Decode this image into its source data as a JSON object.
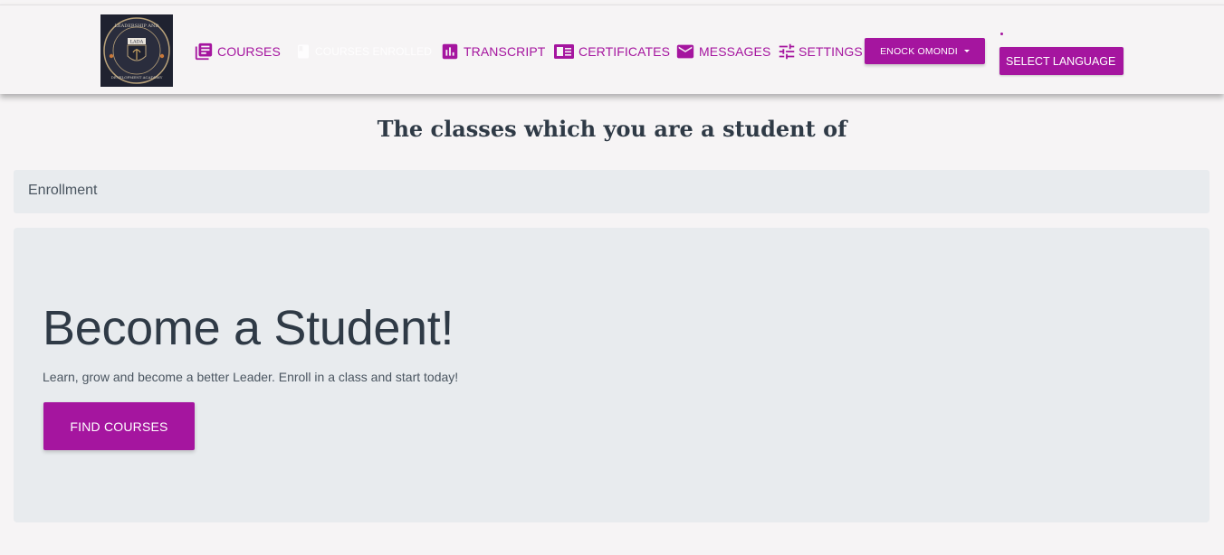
{
  "brand": {
    "logo_text_top": "LEADERSHIP AND",
    "logo_abbr": "LADA",
    "logo_text_bottom": "DEVELOPMENT ACADEMY"
  },
  "nav": {
    "items": [
      {
        "label": "COURSES",
        "icon": "library-books-icon"
      },
      {
        "label": "COURSES ENROLLED",
        "icon": "book-icon"
      },
      {
        "label": "TRANSCRIPT",
        "icon": "bar-chart-icon"
      },
      {
        "label": "CERTIFICATES",
        "icon": "certificate-icon"
      },
      {
        "label": "MESSAGES",
        "icon": "mail-icon"
      },
      {
        "label": "SETTINGS",
        "icon": "tune-icon"
      }
    ],
    "user_menu_label": "ENOCK OMONDI",
    "language_button_label": "SELECT LANGUAGE"
  },
  "main": {
    "title": "The classes which you are a student of",
    "enrollment_header": "Enrollment",
    "jumbotron": {
      "heading": "Become a Student!",
      "text": "Learn, grow and become a better Leader. Enroll in a class and start today!",
      "button_label": "FIND COURSES"
    }
  },
  "colors": {
    "accent": "#a5159f",
    "page_bg": "#f6f4f5",
    "card_bg": "#e8ebee",
    "text_dark": "#2f3a46"
  }
}
